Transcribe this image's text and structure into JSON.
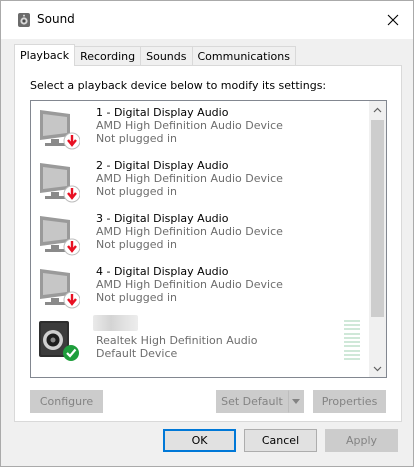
{
  "window": {
    "title": "Sound",
    "icon": "speaker-icon",
    "close_icon": "close-icon"
  },
  "tabs": [
    {
      "label": "Playback",
      "active": true
    },
    {
      "label": "Recording",
      "active": false
    },
    {
      "label": "Sounds",
      "active": false
    },
    {
      "label": "Communications",
      "active": false
    }
  ],
  "panel": {
    "instruction": "Select a playback device below to modify its settings:"
  },
  "devices": [
    {
      "name": "1 - Digital Display Audio",
      "driver": "AMD High Definition Audio Device",
      "status": "Not plugged in",
      "icon": "monitor-icon",
      "badge": "unplugged-arrow-icon"
    },
    {
      "name": "2 - Digital Display Audio",
      "driver": "AMD High Definition Audio Device",
      "status": "Not plugged in",
      "icon": "monitor-icon",
      "badge": "unplugged-arrow-icon"
    },
    {
      "name": "3 - Digital Display Audio",
      "driver": "AMD High Definition Audio Device",
      "status": "Not plugged in",
      "icon": "monitor-icon",
      "badge": "unplugged-arrow-icon"
    },
    {
      "name": "4 - Digital Display Audio",
      "driver": "AMD High Definition Audio Device",
      "status": "Not plugged in",
      "icon": "monitor-icon",
      "badge": "unplugged-arrow-icon"
    },
    {
      "name": "",
      "driver": "Realtek High Definition Audio",
      "status": "Default Device",
      "icon": "speaker-box-icon",
      "badge": "default-check-icon"
    }
  ],
  "buttons": {
    "configure": "Configure",
    "set_default": "Set Default",
    "properties": "Properties",
    "ok": "OK",
    "cancel": "Cancel",
    "apply": "Apply"
  },
  "colors": {
    "accent": "#0078d7",
    "unplugged_badge": "#e81123",
    "default_badge": "#1e9e3c",
    "disabled_text": "#838383"
  }
}
